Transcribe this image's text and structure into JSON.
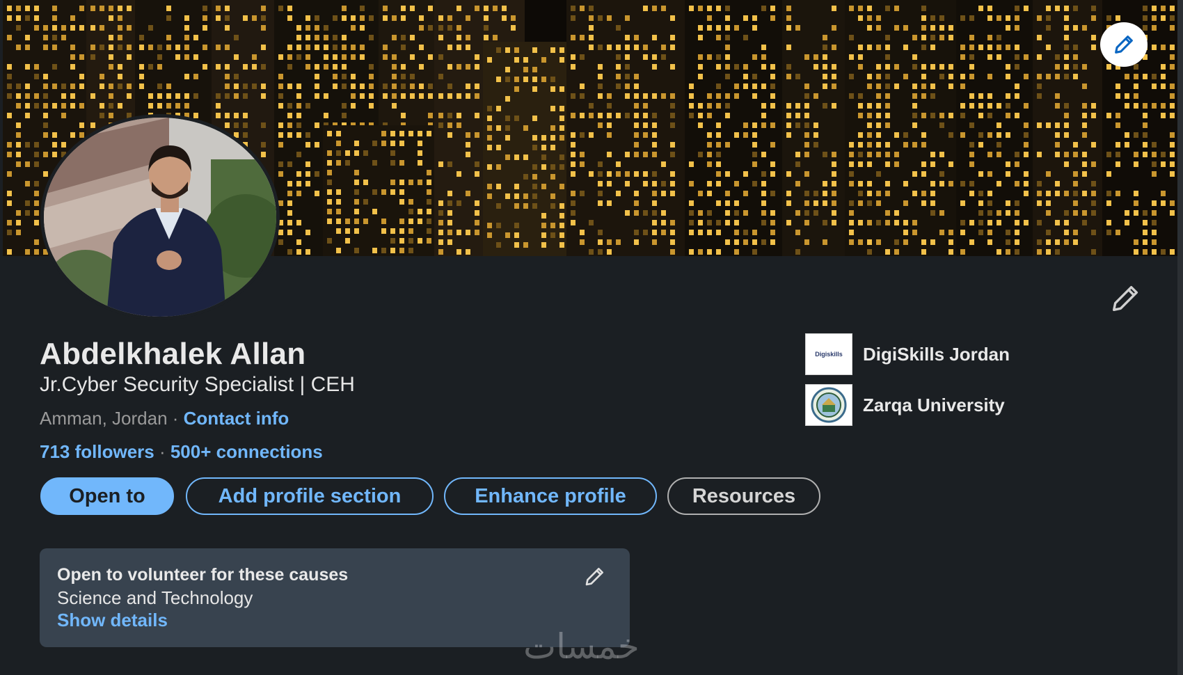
{
  "cover": {
    "edit_icon": "pencil-icon",
    "image_description_icon": "city-skyline-night"
  },
  "profile": {
    "name": "Abdelkhalek Allan",
    "headline": "Jr.Cyber Security Specialist | CEH",
    "location": "Amman, Jordan",
    "separator": " · ",
    "contact_info_label": "Contact info",
    "followers": "713 followers",
    "stats_separator": " · ",
    "connections": "500+ connections"
  },
  "actions": {
    "open_to": "Open to",
    "add_profile_section": "Add profile section",
    "enhance_profile": "Enhance profile",
    "resources": "Resources"
  },
  "organizations": [
    {
      "name": "DigiSkills Jordan",
      "logo_text": "Digiskills"
    },
    {
      "name": "Zarqa University",
      "logo_text": ""
    }
  ],
  "volunteer": {
    "title": "Open to volunteer for these causes",
    "cause": "Science and Technology",
    "link": "Show details"
  },
  "watermark": "خمسات",
  "colors": {
    "background": "#1b1f23",
    "accent_blue": "#71b7fb",
    "card_gray": "#38434f",
    "text_primary": "#e9e9e9",
    "text_secondary": "#9a9a9a"
  }
}
